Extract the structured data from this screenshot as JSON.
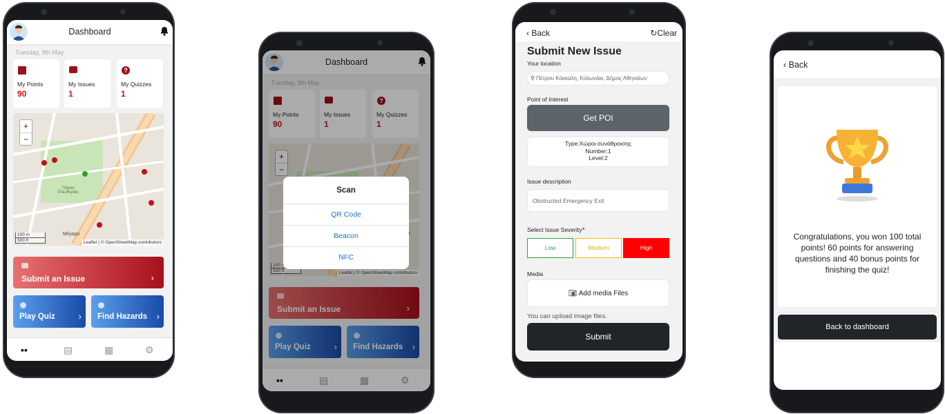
{
  "dashboard": {
    "title": "Dashboard",
    "date": "Tuesday, 9th May",
    "cards": [
      {
        "label": "My Points",
        "value": "90",
        "icon": "gift-icon"
      },
      {
        "label": "My Issues",
        "value": "1",
        "icon": "message-icon"
      },
      {
        "label": "My Quizzes",
        "value": "1",
        "icon": "question-icon"
      }
    ],
    "map": {
      "zoom_in": "+",
      "zoom_out": "−",
      "scale_m": "100 m",
      "scale_ft": "500 ft",
      "attribution": "Leaflet | © OpenStreetMap contributors",
      "park_label": "Πάρκο Ελευθερίας",
      "place_label": "Μέγαρο"
    },
    "submit_issue": "Submit an Issue",
    "play_quiz": "Play Quiz",
    "find_hazards": "Find Hazards",
    "nav": [
      "dashboard-icon",
      "clipboard-icon",
      "gift-icon",
      "gear-icon"
    ],
    "colors": {
      "accent_red": "#c0141c",
      "blue": "#1a4aa8"
    }
  },
  "scan_modal": {
    "title": "Scan",
    "options": [
      "QR Code",
      "Beacon",
      "NFC"
    ]
  },
  "submit_form": {
    "back": "Back",
    "clear": "Clear",
    "title": "Submit New Issue",
    "location_label": "Your location",
    "location_value": "Πέτρου Κόκκαλη, Κολωνάκι, Δήμος Αθηναίων",
    "poi_label": "Point of Interest",
    "get_poi": "Get POI",
    "poi_info": [
      "Type:Χώροι συνάθροισης",
      "Number:1",
      "Level:2"
    ],
    "description_label": "Issue description",
    "description_value": "Obstructed Emergency Exit",
    "severity_label": "Select Issue Severity",
    "required_mark": "*",
    "severity": [
      {
        "label": "Low",
        "color": "#28a745"
      },
      {
        "label": "Medium",
        "color": "#f5c000"
      },
      {
        "label": "High",
        "color": "#ff0000",
        "selected": true
      }
    ],
    "media_label": "Media",
    "add_media": "Add media Files",
    "upload_hint": "You can upload image files.",
    "submit": "Submit"
  },
  "quiz_result": {
    "back": "Back",
    "message": "Congratulations, you won 100 total points! 60 points for answering questions and 40 bonus points for finishing the quiz!",
    "back_to_dashboard": "Back to dashboard"
  }
}
